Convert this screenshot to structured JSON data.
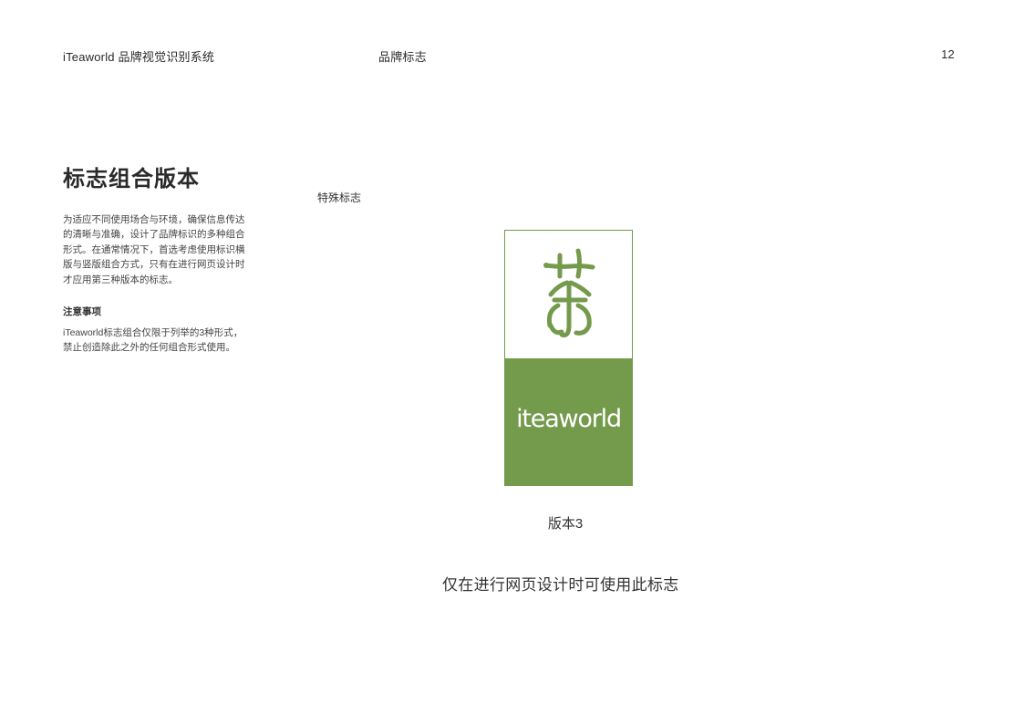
{
  "header": {
    "left": "iTeaworld 品牌视觉识别系统",
    "center": "品牌标志",
    "page_number": "12"
  },
  "section": {
    "title": "标志组合版本",
    "intro": "为适应不同使用场合与环境，确保信息传达的清晰与准确，设计了品牌标识的多种组合形式。在通常情况下，首选考虑使用标识横版与竖版组合方式，只有在进行网页设计时才应用第三种版本的标志。",
    "note_heading": "注意事项",
    "note_text": "iTeaworld标志组合仅限于列举的3种形式，禁止创造除此之外的任何组合形式使用。"
  },
  "display": {
    "special_label": "特殊标志",
    "wordmark": "iteaworld",
    "version_label": "版本3",
    "usage_note": "仅在进行网页设计时可使用此标志"
  },
  "colors": {
    "brand_green": "#749a4c",
    "background": "#ffffff",
    "text": "#2b2b2b"
  },
  "icons": {
    "logo_symbol": "tea-character-logo-icon"
  }
}
